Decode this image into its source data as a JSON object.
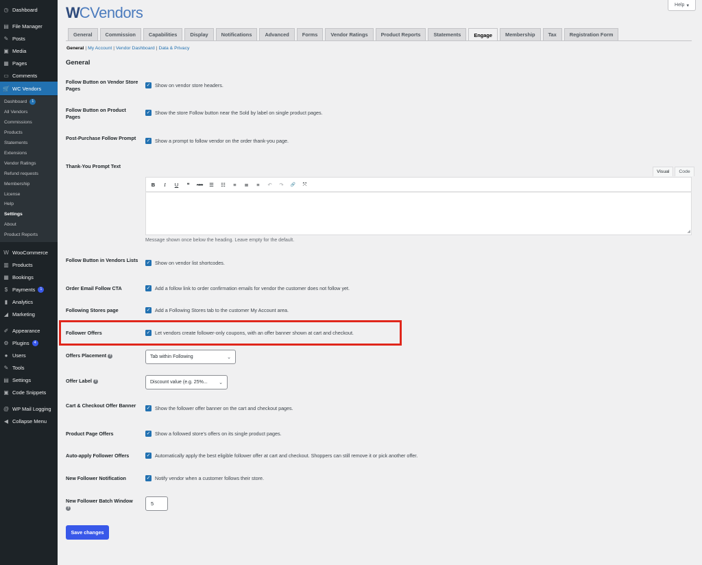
{
  "sidebar": {
    "top_items": [
      {
        "label": "Dashboard",
        "icon": "dashboard-icon",
        "glyph": "◷"
      },
      {
        "label": "File Manager",
        "icon": "file-manager-icon",
        "glyph": "▤"
      },
      {
        "label": "Posts",
        "icon": "pin-icon",
        "glyph": "✎"
      },
      {
        "label": "Media",
        "icon": "media-icon",
        "glyph": "▣"
      },
      {
        "label": "Pages",
        "icon": "pages-icon",
        "glyph": "▦"
      },
      {
        "label": "Comments",
        "icon": "comment-icon",
        "glyph": "▭"
      },
      {
        "label": "WC Vendors",
        "icon": "cart-icon",
        "glyph": "🛒"
      }
    ],
    "submenu": [
      {
        "label": "Dashboard",
        "badge": "1"
      },
      {
        "label": "All Vendors"
      },
      {
        "label": "Commissions"
      },
      {
        "label": "Products"
      },
      {
        "label": "Statements"
      },
      {
        "label": "Extensions"
      },
      {
        "label": "Vendor Ratings"
      },
      {
        "label": "Refund requests"
      },
      {
        "label": "Membership"
      },
      {
        "label": "License"
      },
      {
        "label": "Help"
      },
      {
        "label": "Settings"
      },
      {
        "label": "About"
      },
      {
        "label": "Product Reports"
      }
    ],
    "bottom_items": [
      {
        "label": "WooCommerce",
        "icon": "woocommerce-icon",
        "glyph": "W"
      },
      {
        "label": "Products",
        "icon": "products-icon",
        "glyph": "▥"
      },
      {
        "label": "Bookings",
        "icon": "calendar-icon",
        "glyph": "▦"
      },
      {
        "label": "Payments",
        "icon": "payments-icon",
        "glyph": "$",
        "badge": "1"
      },
      {
        "label": "Analytics",
        "icon": "analytics-icon",
        "glyph": "▮"
      },
      {
        "label": "Marketing",
        "icon": "megaphone-icon",
        "glyph": "◢"
      },
      {
        "label": "Appearance",
        "icon": "brush-icon",
        "glyph": "✐"
      },
      {
        "label": "Plugins",
        "icon": "plugin-icon",
        "glyph": "⚙",
        "badge": "4"
      },
      {
        "label": "Users",
        "icon": "users-icon",
        "glyph": "●"
      },
      {
        "label": "Tools",
        "icon": "wrench-icon",
        "glyph": "✎"
      },
      {
        "label": "Settings",
        "icon": "settings-icon",
        "glyph": "▤"
      },
      {
        "label": "Code Snippets",
        "icon": "code-icon",
        "glyph": "▣"
      },
      {
        "label": "WP Mail Logging",
        "icon": "mail-icon",
        "glyph": "@"
      },
      {
        "label": "Collapse Menu",
        "icon": "collapse-icon",
        "glyph": "◀"
      }
    ]
  },
  "logo": {
    "mark": "W",
    "text": "CVendors"
  },
  "help": {
    "label": "Help",
    "chevron": "▾"
  },
  "tabs": [
    "General",
    "Commission",
    "Capabilities",
    "Display",
    "Notifications",
    "Advanced",
    "Forms",
    "Vendor Ratings",
    "Product Reports",
    "Statements",
    "Engage",
    "Membership",
    "Tax",
    "Registration Form"
  ],
  "active_tab": "Engage",
  "subnav": {
    "general": "General",
    "my_account": "My Account",
    "vendor_dashboard": "Vendor Dashboard",
    "data_privacy": "Data & Privacy",
    "sep": "|"
  },
  "section_title": "General",
  "settings": {
    "follow_store": {
      "label": "Follow Button on Vendor Store Pages",
      "text": "Show on vendor store headers."
    },
    "follow_product": {
      "label": "Follow Button on Product Pages",
      "text": "Show the store Follow button near the Sold by label on single product pages."
    },
    "post_purchase": {
      "label": "Post-Purchase Follow Prompt",
      "text": "Show a prompt to follow vendor on the order thank-you page."
    },
    "thankyou": {
      "label": "Thank-You Prompt Text",
      "tab_visual": "Visual",
      "tab_code": "Code",
      "desc": "Message shown once below the heading. Leave empty for the default."
    },
    "vendors_lists": {
      "label": "Follow Button in Vendors Lists",
      "text": "Show on vendor list shortcodes."
    },
    "order_email": {
      "label": "Order Email Follow CTA",
      "text": "Add a follow link to order confirmation emails for vendor the customer does not follow yet."
    },
    "following_page": {
      "label": "Following Stores page",
      "text": "Add a Following Stores tab to the customer My Account area."
    },
    "follower_offers": {
      "label": "Follower Offers",
      "text": "Let vendors create follower-only coupons, with an offer banner shown at cart and checkout."
    },
    "offers_placement": {
      "label": "Offers Placement",
      "value": "Tab within Following"
    },
    "offer_label": {
      "label": "Offer Label",
      "value": "Discount value (e.g. 25%..."
    },
    "cart_banner": {
      "label": "Cart & Checkout Offer Banner",
      "text": "Show the follower offer banner on the cart and checkout pages."
    },
    "product_offers": {
      "label": "Product Page Offers",
      "text": "Show a followed store's offers on its single product pages."
    },
    "auto_apply": {
      "label": "Auto-apply Follower Offers",
      "text": "Automatically apply the best eligible follower offer at cart and checkout. Shoppers can still remove it or pick another offer."
    },
    "new_follower": {
      "label": "New Follower Notification",
      "text": "Notify vendor when a customer follows their store."
    },
    "batch_window": {
      "label": "New Follower Batch Window",
      "value": "5"
    }
  },
  "toolbar_icons": [
    {
      "name": "bold-icon",
      "glyph": "B"
    },
    {
      "name": "italic-icon",
      "glyph": "I"
    },
    {
      "name": "underline-icon",
      "glyph": "U"
    },
    {
      "name": "quote-icon",
      "glyph": "❝"
    },
    {
      "name": "strikethrough-icon",
      "glyph": "ABC"
    },
    {
      "name": "bullet-list-icon",
      "glyph": "☰"
    },
    {
      "name": "numbered-list-icon",
      "glyph": "☷"
    },
    {
      "name": "align-left-icon",
      "glyph": "≡"
    },
    {
      "name": "align-center-icon",
      "glyph": "≣"
    },
    {
      "name": "align-right-icon",
      "glyph": "≡"
    },
    {
      "name": "undo-icon",
      "glyph": "↶"
    },
    {
      "name": "redo-icon",
      "glyph": "↷"
    },
    {
      "name": "link-icon",
      "glyph": "🔗"
    },
    {
      "name": "fullscreen-icon",
      "glyph": "⤧"
    }
  ],
  "save_label": "Save changes",
  "colors": {
    "accent": "#3858e9",
    "sidebar": "#1d2327",
    "highlight": "#e0261b",
    "checkbox": "#2271b1"
  }
}
